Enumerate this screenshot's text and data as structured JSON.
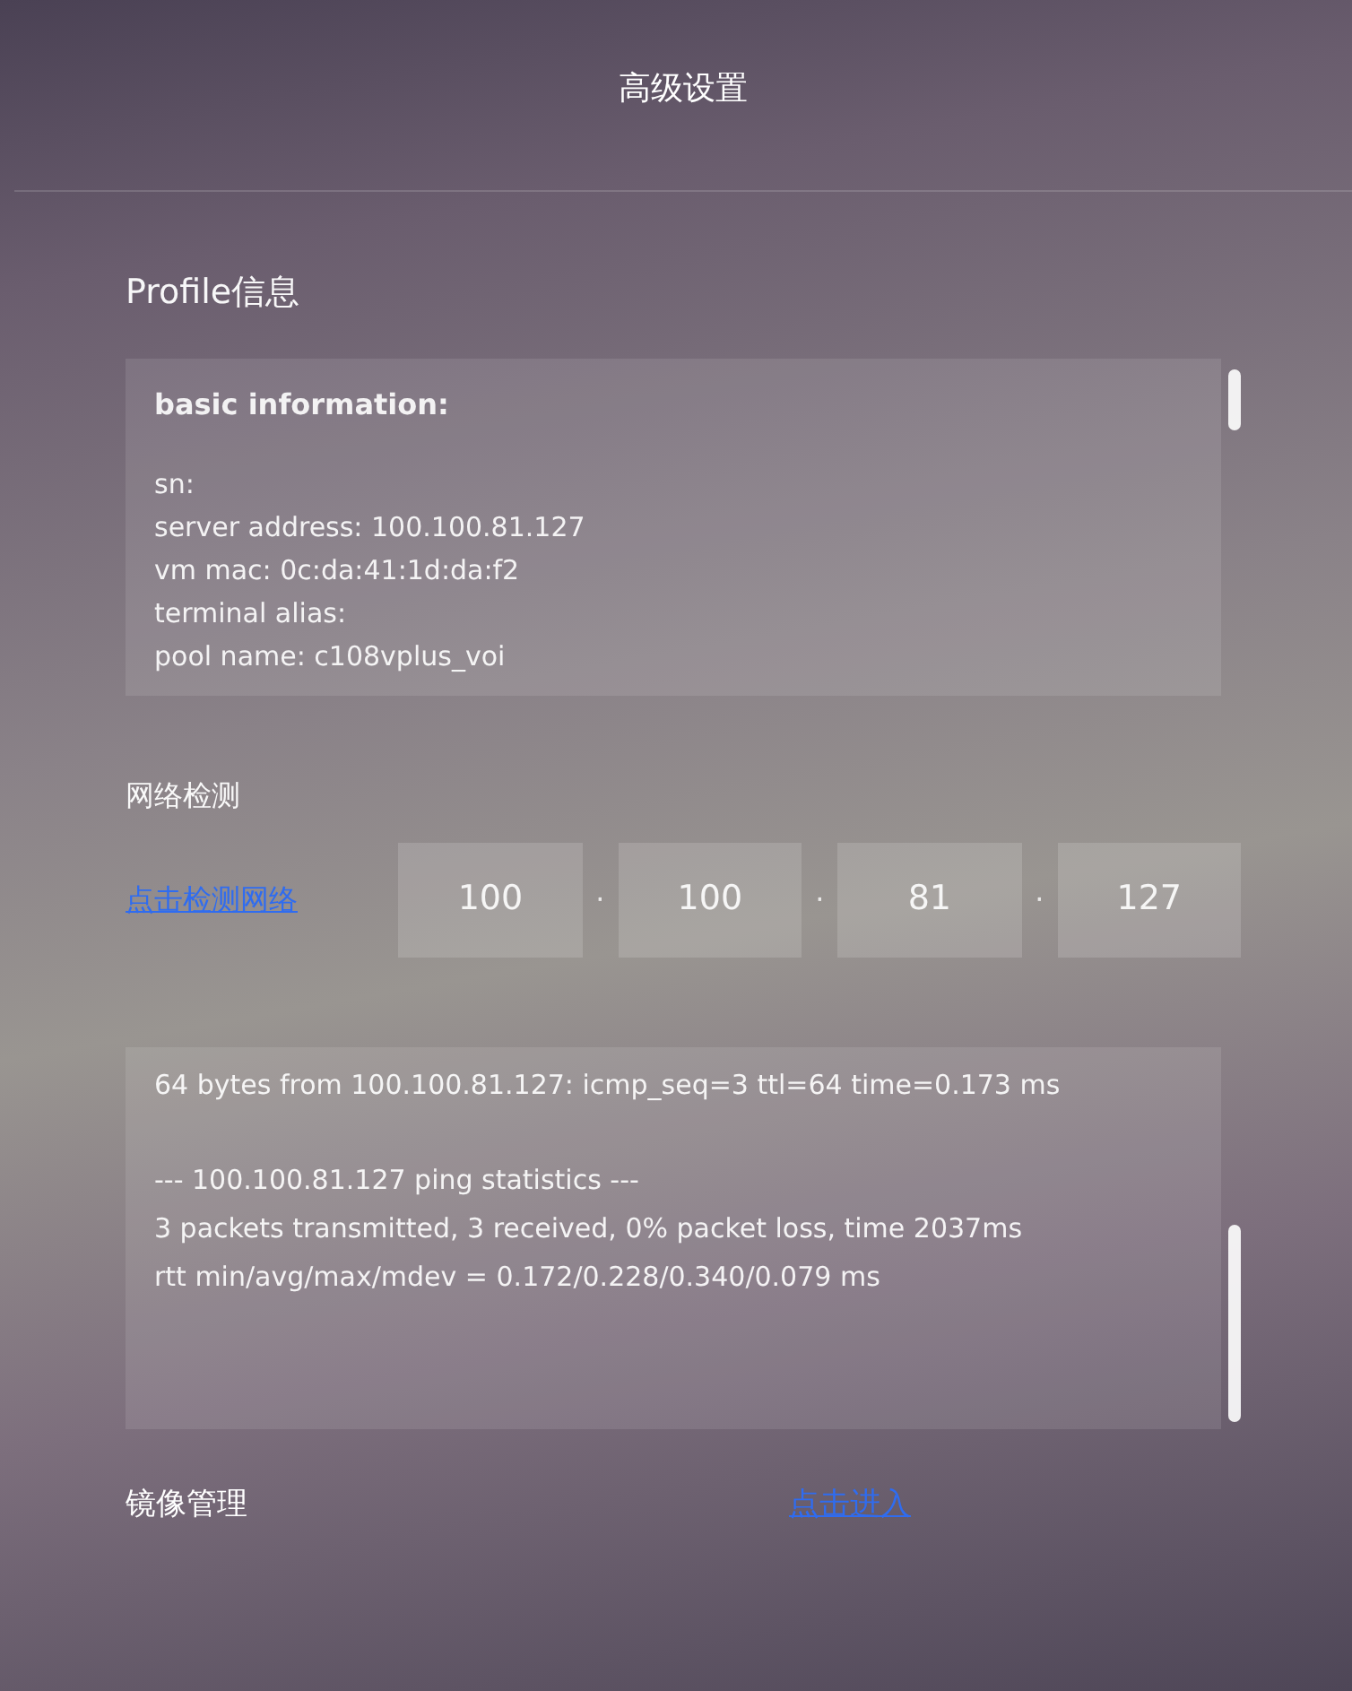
{
  "header": {
    "title": "高级设置"
  },
  "profile": {
    "heading": "Profile信息",
    "box_title": "basic information:",
    "lines": [
      "sn:",
      "server address: 100.100.81.127",
      "vm mac: 0c:da:41:1d:da:f2",
      "terminal alias:",
      "pool name: c108vplus_voi"
    ]
  },
  "network": {
    "heading": "网络检测",
    "link": "点击检测网络",
    "ip_octets": [
      "100",
      "100",
      "81",
      "127"
    ],
    "separators": [
      "·",
      "·",
      "·"
    ],
    "output_blocks": [
      [
        "64 bytes from 100.100.81.127: icmp_seq=3 ttl=64 time=0.173 ms"
      ],
      [
        "--- 100.100.81.127 ping statistics ---",
        "3 packets transmitted, 3 received, 0% packet loss, time 2037ms",
        "rtt min/avg/max/mdev = 0.172/0.228/0.340/0.079 ms"
      ]
    ]
  },
  "image_management": {
    "label": "镜像管理",
    "link": "点击进入"
  }
}
